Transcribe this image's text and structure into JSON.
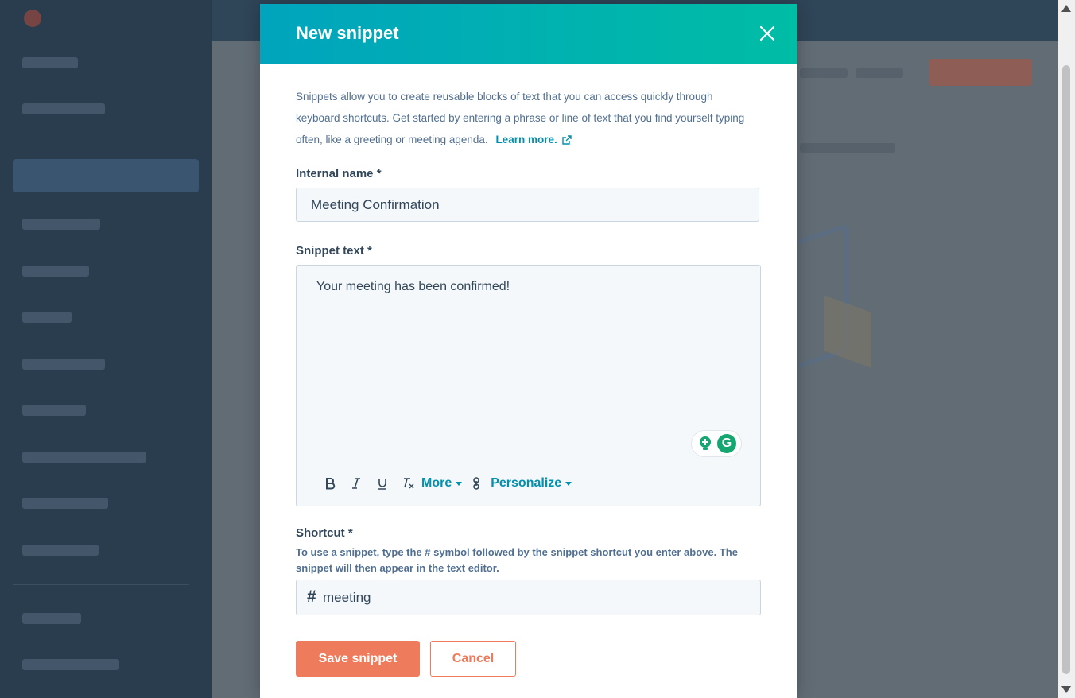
{
  "modal": {
    "title": "New snippet",
    "intro_text": "Snippets allow you to create reusable blocks of text that you can access quickly through keyboard shortcuts. Get started by entering a phrase or line of text that you find yourself typing often, like a greeting or meeting agenda.",
    "learn_more_label": "Learn more.",
    "internal_name": {
      "label": "Internal name *",
      "value": "Meeting Confirmation"
    },
    "snippet_text": {
      "label": "Snippet text *",
      "value": "Your meeting has been confirmed!"
    },
    "toolbar": {
      "more_label": "More",
      "personalize_label": "Personalize"
    },
    "shortcut": {
      "label": "Shortcut *",
      "hint": "To use a snippet, type the # symbol followed by the snippet shortcut you enter above. The snippet will then appear in the text editor.",
      "prefix": "#",
      "value": "meeting"
    },
    "buttons": {
      "save_label": "Save snippet",
      "cancel_label": "Cancel"
    }
  },
  "colors": {
    "header_gradient_start": "#00a4bd",
    "header_gradient_end": "#00bda5",
    "primary_button": "#ee7b5b",
    "link": "#0091ae",
    "text": "#33475b",
    "muted_text": "#516f90"
  }
}
